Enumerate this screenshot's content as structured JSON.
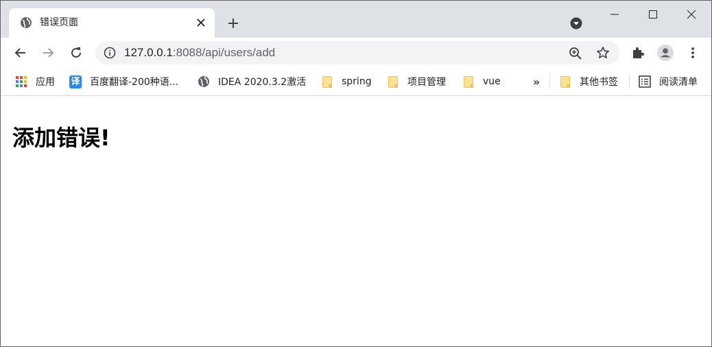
{
  "tab": {
    "title": "错误页面",
    "favicon": "globe-icon"
  },
  "window_controls": [
    "minimize-icon",
    "maximize-icon",
    "close-icon"
  ],
  "address_bar": {
    "host": "127.0.0.1",
    "path": ":8088/api/users/add"
  },
  "bookmarks": {
    "items": [
      {
        "label": "应用",
        "icon": "apps-grid-icon"
      },
      {
        "label": "百度翻译-200种语...",
        "icon": "translate-icon",
        "badge": "译"
      },
      {
        "label": "IDEA 2020.3.2激活",
        "icon": "globe-icon"
      },
      {
        "label": "spring",
        "icon": "folder-icon"
      },
      {
        "label": "项目管理",
        "icon": "folder-icon"
      },
      {
        "label": "vue",
        "icon": "folder-icon"
      }
    ],
    "overflow": "»",
    "other": {
      "label": "其他书签",
      "icon": "folder-icon"
    },
    "reading_list": {
      "label": "阅读清单",
      "icon": "reading-list-icon"
    }
  },
  "page": {
    "heading": "添加错误!"
  },
  "colors": {
    "tabstrip": "#dee1e6",
    "omnibox": "#f1f3f4",
    "folder": "#fde293",
    "translate": "#2b87e8"
  }
}
